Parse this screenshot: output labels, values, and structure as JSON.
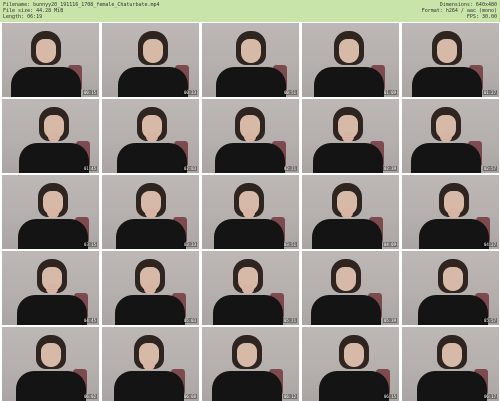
{
  "header": {
    "filename": "Filename: bunnyy20_191116_1708_female_Chaturbate.mp4",
    "filesize": "File size: 44.28 MiB",
    "length": "Length: 06:19",
    "dimensions": "Dimensions: 640x480",
    "format": "Format: h264 / aac (mono)",
    "fps": "FPS: 30.00"
  },
  "thumbnails": [
    {
      "timestamp": "00:15",
      "hand": false
    },
    {
      "timestamp": "00:33",
      "hand": false
    },
    {
      "timestamp": "00:51",
      "hand": false
    },
    {
      "timestamp": "01:09",
      "hand": false
    },
    {
      "timestamp": "01:27",
      "hand": false
    },
    {
      "timestamp": "01:45",
      "hand": true
    },
    {
      "timestamp": "02:03",
      "hand": true
    },
    {
      "timestamp": "02:21",
      "hand": true
    },
    {
      "timestamp": "02:39",
      "hand": true
    },
    {
      "timestamp": "02:57",
      "hand": true
    },
    {
      "timestamp": "03:15",
      "hand": true
    },
    {
      "timestamp": "03:33",
      "hand": true
    },
    {
      "timestamp": "03:51",
      "hand": true
    },
    {
      "timestamp": "04:09",
      "hand": true
    },
    {
      "timestamp": "04:27",
      "hand": true
    },
    {
      "timestamp": "04:45",
      "hand": true
    },
    {
      "timestamp": "05:03",
      "hand": true
    },
    {
      "timestamp": "05:21",
      "hand": true
    },
    {
      "timestamp": "05:39",
      "hand": false
    },
    {
      "timestamp": "05:57",
      "hand": false
    },
    {
      "timestamp": "06:02",
      "hand": false
    },
    {
      "timestamp": "06:08",
      "hand": true
    },
    {
      "timestamp": "06:12",
      "hand": false
    },
    {
      "timestamp": "06:15",
      "hand": false
    },
    {
      "timestamp": "06:17",
      "hand": false
    }
  ]
}
